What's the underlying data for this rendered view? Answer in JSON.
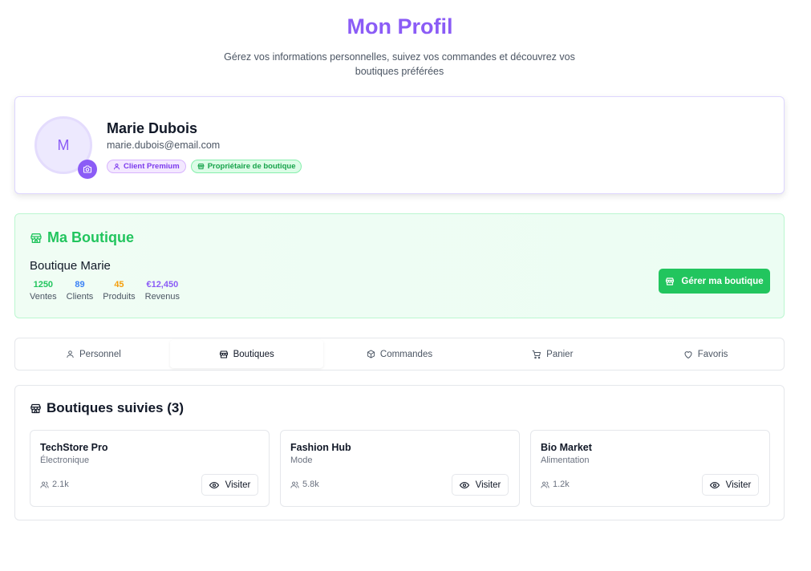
{
  "page": {
    "title": "Mon Profil",
    "subtitle": "Gérez vos informations personnelles, suivez vos commandes et découvrez vos boutiques préférées"
  },
  "profile": {
    "avatar_initial": "M",
    "name": "Marie Dubois",
    "email": "marie.dubois@email.com",
    "badges": [
      {
        "label": "Client Premium",
        "icon": "user-icon"
      },
      {
        "label": "Propriétaire de boutique",
        "icon": "store-icon"
      }
    ],
    "camera_icon": "camera-icon"
  },
  "boutique": {
    "heading": "Ma Boutique",
    "name": "Boutique Marie",
    "stats": [
      {
        "value": "1250",
        "label": "Ventes",
        "color": "#22c55e"
      },
      {
        "value": "89",
        "label": "Clients",
        "color": "#3b82f6"
      },
      {
        "value": "45",
        "label": "Produits",
        "color": "#f59e0b"
      },
      {
        "value": "€12,450",
        "label": "Revenus",
        "color": "#8b5cf6"
      }
    ],
    "manage_label": "Gérer ma boutique"
  },
  "tabs": [
    {
      "label": "Personnel",
      "icon": "user-icon",
      "active": false
    },
    {
      "label": "Boutiques",
      "icon": "store-icon",
      "active": true
    },
    {
      "label": "Commandes",
      "icon": "package-icon",
      "active": false
    },
    {
      "label": "Panier",
      "icon": "cart-icon",
      "active": false
    },
    {
      "label": "Favoris",
      "icon": "heart-icon",
      "active": false
    }
  ],
  "followed": {
    "heading": "Boutiques suivies (3)",
    "visit_label": "Visiter",
    "shops": [
      {
        "name": "TechStore Pro",
        "category": "Électronique",
        "followers": "2.1k"
      },
      {
        "name": "Fashion Hub",
        "category": "Mode",
        "followers": "5.8k"
      },
      {
        "name": "Bio Market",
        "category": "Alimentation",
        "followers": "1.2k"
      }
    ]
  },
  "colors": {
    "accent_purple": "#8b5cf6",
    "accent_green": "#22c55e"
  }
}
